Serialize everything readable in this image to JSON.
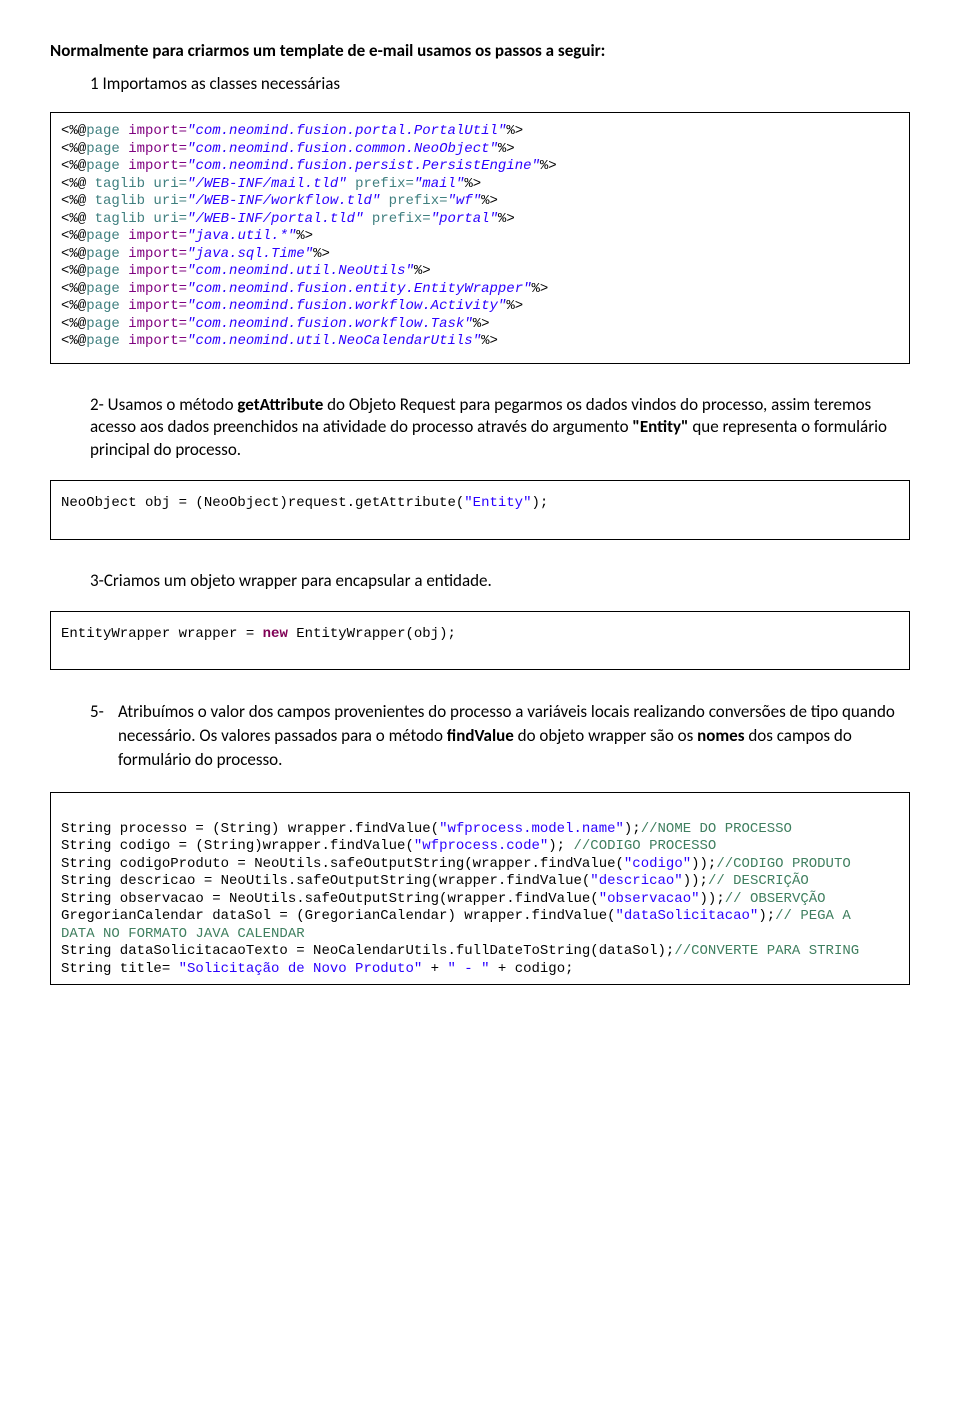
{
  "h1": "Normalmente para criarmos um template de e-mail usamos os passos a seguir:",
  "step1": "1 Importamos as classes necessárias",
  "code1": {
    "lines": [
      [
        [
          "<%@",
          " br"
        ],
        [
          "page",
          " bl"
        ],
        [
          " import=",
          " attr"
        ],
        [
          "\"com.neomind.fusion.portal.PortalUtil\"",
          " str"
        ],
        [
          "%>",
          " br"
        ]
      ],
      [
        [
          "<%@",
          " br"
        ],
        [
          "page",
          " bl"
        ],
        [
          " import=",
          " attr"
        ],
        [
          "\"com.neomind.fusion.common.NeoObject\"",
          " str"
        ],
        [
          "%>",
          " br"
        ]
      ],
      [
        [
          "<%@",
          " br"
        ],
        [
          "page",
          " bl"
        ],
        [
          " import=",
          " attr"
        ],
        [
          "\"com.neomind.fusion.persist.PersistEngine\"",
          " str"
        ],
        [
          "%>",
          " br"
        ]
      ],
      [
        [
          "<%@",
          " br"
        ],
        [
          " taglib uri=",
          " bl"
        ],
        [
          "\"/WEB-INF/mail.tld\"",
          " str"
        ],
        [
          " prefix=",
          " bl"
        ],
        [
          "\"mail\"",
          " str"
        ],
        [
          "%>",
          " br"
        ]
      ],
      [
        [
          "<%@",
          " br"
        ],
        [
          " taglib uri=",
          " bl"
        ],
        [
          "\"/WEB-INF/workflow.tld\"",
          " str"
        ],
        [
          " prefix=",
          " bl"
        ],
        [
          "\"wf\"",
          " str"
        ],
        [
          "%>",
          " br"
        ]
      ],
      [
        [
          "<%@",
          " br"
        ],
        [
          " taglib uri=",
          " bl"
        ],
        [
          "\"/WEB-INF/portal.tld\"",
          " str"
        ],
        [
          " prefix=",
          " bl"
        ],
        [
          "\"portal\"",
          " str"
        ],
        [
          "%>",
          " br"
        ]
      ],
      [
        [
          "<%@",
          " br"
        ],
        [
          "page",
          " bl"
        ],
        [
          " import=",
          " attr"
        ],
        [
          "\"java.util.*\"",
          " str"
        ],
        [
          "%>",
          " br"
        ]
      ],
      [
        [
          "<%@",
          " br"
        ],
        [
          "page",
          " bl"
        ],
        [
          " import=",
          " attr"
        ],
        [
          "\"java.sql.Time\"",
          " str"
        ],
        [
          "%>",
          " br"
        ]
      ],
      [
        [
          "<%@",
          " br"
        ],
        [
          "page",
          " bl"
        ],
        [
          " import=",
          " attr"
        ],
        [
          "\"com.neomind.util.NeoUtils\"",
          " str"
        ],
        [
          "%>",
          " br"
        ]
      ],
      [
        [
          "<%@",
          " br"
        ],
        [
          "page",
          " bl"
        ],
        [
          " import=",
          " attr"
        ],
        [
          "\"com.neomind.fusion.entity.EntityWrapper\"",
          " str"
        ],
        [
          "%>",
          " br"
        ]
      ],
      [
        [
          "<%@",
          " br"
        ],
        [
          "page",
          " bl"
        ],
        [
          " import=",
          " attr"
        ],
        [
          "\"com.neomind.fusion.workflow.Activity\"",
          " str"
        ],
        [
          "%>",
          " br"
        ]
      ],
      [
        [
          "<%@",
          " br"
        ],
        [
          "page",
          " bl"
        ],
        [
          " import=",
          " attr"
        ],
        [
          "\"com.neomind.fusion.workflow.Task\"",
          " str"
        ],
        [
          "%>",
          " br"
        ]
      ],
      [
        [
          "<%@",
          " br"
        ],
        [
          "page",
          " bl"
        ],
        [
          " import=",
          " attr"
        ],
        [
          "\"com.neomind.util.NeoCalendarUtils\"",
          " str"
        ],
        [
          "%>",
          " br"
        ]
      ]
    ]
  },
  "para2_a": "2- Usamos o método ",
  "para2_b": "getAttribute",
  "para2_c": "  do Objeto Request para pegarmos os dados vindos do processo, assim teremos acesso aos dados preenchidos na atividade do processo através do argumento ",
  "para2_d": "\"Entity\"",
  "para2_e": " que representa o formulário principal do processo.",
  "code2": [
    [
      [
        "NeoObject obj = (NeoObject)request.getAttribute(",
        " br"
      ],
      [
        "\"Entity\"",
        " strn"
      ],
      [
        ");",
        " br"
      ]
    ]
  ],
  "step3": "3-Criamos um objeto wrapper para encapsular a entidade.",
  "code3": [
    [
      [
        "EntityWrapper wrapper = ",
        " br"
      ],
      [
        "new",
        " kw"
      ],
      [
        " EntityWrapper(obj);",
        " br"
      ]
    ]
  ],
  "step5_marker": "5-",
  "step5_a": "Atribuímos o valor dos campos provenientes do processo a variáveis locais realizando conversões de tipo quando necessário.  Os valores passados para o método ",
  "step5_b": "findValue",
  "step5_c": " do objeto wrapper são os ",
  "step5_d": "nomes",
  "step5_e": " dos campos do formulário do processo.",
  "code5": [
    [
      [
        "String processo = (String) wrapper.findValue(",
        " br"
      ],
      [
        "\"wfprocess.model.name\"",
        " strn"
      ],
      [
        ");",
        " br"
      ],
      [
        "//NOME DO PROCESSO",
        " cm"
      ]
    ],
    [
      [
        "String codigo = (String)wrapper.findValue(",
        " br"
      ],
      [
        "\"wfprocess.code\"",
        " strn"
      ],
      [
        "); ",
        " br"
      ],
      [
        "//CODIGO PROCESSO",
        " cm"
      ]
    ],
    [
      [
        "String codigoProduto = NeoUtils.safeOutputString(wrapper.findValue(",
        " br"
      ],
      [
        "\"codigo\"",
        " strn"
      ],
      [
        "));",
        " br"
      ],
      [
        "//CODIGO PRODUTO",
        " cm"
      ]
    ],
    [
      [
        "String descricao = NeoUtils.safeOutputString(wrapper.findValue(",
        " br"
      ],
      [
        "\"descricao\"",
        " strn"
      ],
      [
        "));",
        " br"
      ],
      [
        "// DESCRIÇÃO",
        " cm"
      ]
    ],
    [
      [
        "String observacao = NeoUtils.safeOutputString(wrapper.findValue(",
        " br"
      ],
      [
        "\"observacao\"",
        " strn"
      ],
      [
        "));",
        " br"
      ],
      [
        "// OBSERVÇÃO",
        " cm"
      ]
    ],
    [
      [
        "GregorianCalendar dataSol = (GregorianCalendar) wrapper.findValue(",
        " br"
      ],
      [
        "\"dataSolicitacao\"",
        " strn"
      ],
      [
        ");",
        " br"
      ],
      [
        "// PEGA A ",
        " cm"
      ]
    ],
    [
      [
        "DATA NO FORMATO JAVA CALENDAR",
        " cm"
      ]
    ],
    [
      [
        "String dataSolicitacaoTexto = NeoCalendarUtils.fullDateToString(dataSol);",
        " br"
      ],
      [
        "//CONVERTE PARA STRING",
        " cm"
      ]
    ],
    [
      [
        "String title= ",
        " br"
      ],
      [
        "\"Solicitação de Novo Produto\"",
        " strn"
      ],
      [
        " + ",
        " br"
      ],
      [
        "\" - \"",
        " strn"
      ],
      [
        " + codigo;",
        " br"
      ]
    ]
  ]
}
